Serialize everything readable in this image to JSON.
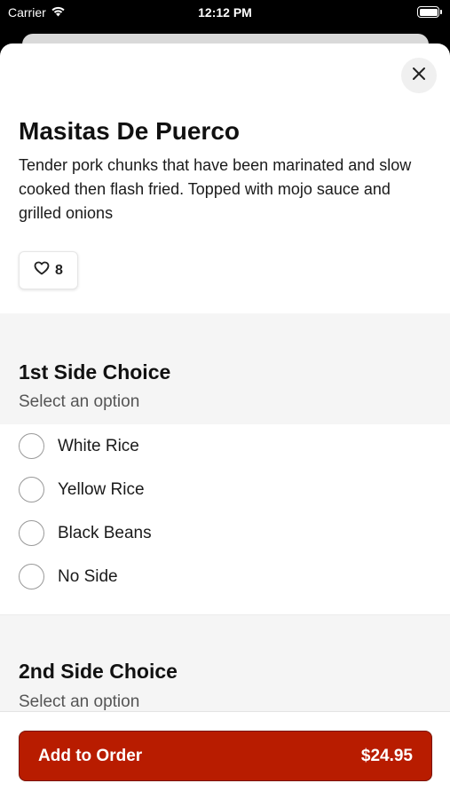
{
  "status_bar": {
    "carrier": "Carrier",
    "time": "12:12 PM",
    "wifi_icon": "wifi-icon",
    "battery_icon": "battery-icon"
  },
  "item": {
    "title": "Masitas De Puerco",
    "description": "Tender pork chunks that have been marinated and slow cooked then flash fried. Topped with mojo sauce and grilled onions",
    "likes": "8",
    "like_icon": "heart-icon"
  },
  "sections": [
    {
      "title": "1st Side Choice",
      "subtitle": "Select an option",
      "options": [
        "White Rice",
        "Yellow Rice",
        "Black Beans",
        "No Side"
      ]
    },
    {
      "title": "2nd Side Choice",
      "subtitle": "Select an option"
    }
  ],
  "footer": {
    "add_label": "Add to Order",
    "price": "$24.95"
  },
  "colors": {
    "accent": "#b81c00",
    "section_bg": "#f5f5f5"
  }
}
